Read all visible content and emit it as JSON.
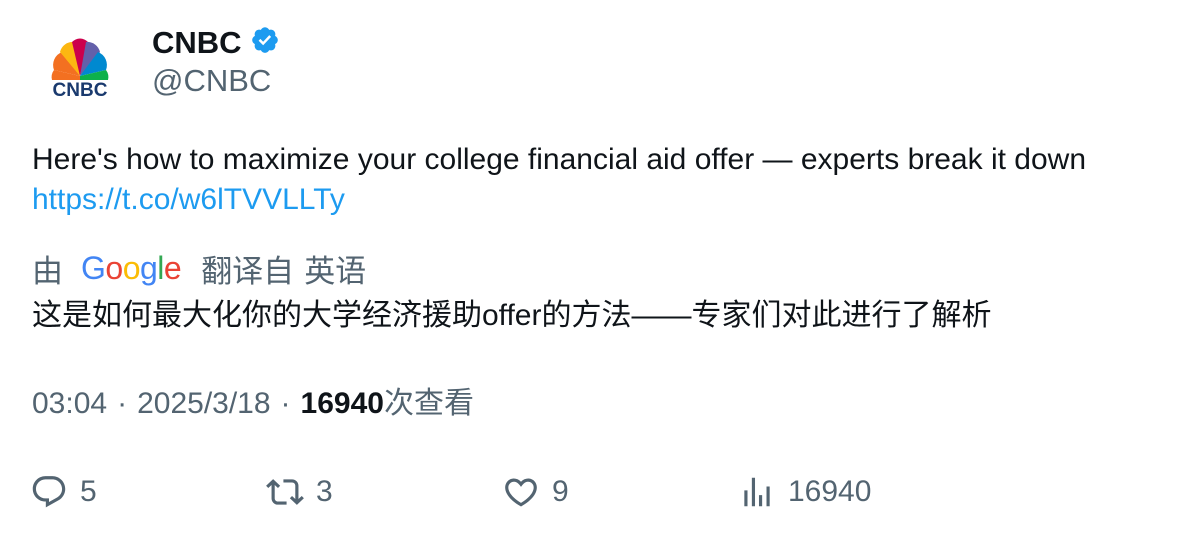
{
  "account": {
    "display_name": "CNBC",
    "handle": "@CNBC",
    "verified": true,
    "avatar_text": "CNBC"
  },
  "tweet": {
    "text": "Here's how to maximize your college financial aid offer — experts break it down",
    "link": "https://t.co/w6lTVVLLTy"
  },
  "translation": {
    "by_label": "由",
    "provider": "Google",
    "from_label": "翻译自",
    "language": "英语",
    "text": "这是如何最大化你的大学经济援助offer的方法——专家们对此进行了解析"
  },
  "meta": {
    "time": "03:04",
    "date": "2025/3/18",
    "views_count": "16940",
    "views_label": "次查看"
  },
  "actions": {
    "replies": "5",
    "retweets": "3",
    "likes": "9",
    "views": "16940"
  },
  "icons": {
    "verified": "verified-badge-icon",
    "reply": "reply-icon",
    "retweet": "retweet-icon",
    "like": "heart-icon",
    "views": "analytics-icon"
  },
  "colors": {
    "text_primary": "#0f1419",
    "text_secondary": "#536471",
    "link": "#1d9bf0",
    "verified": "#1d9bf0"
  }
}
